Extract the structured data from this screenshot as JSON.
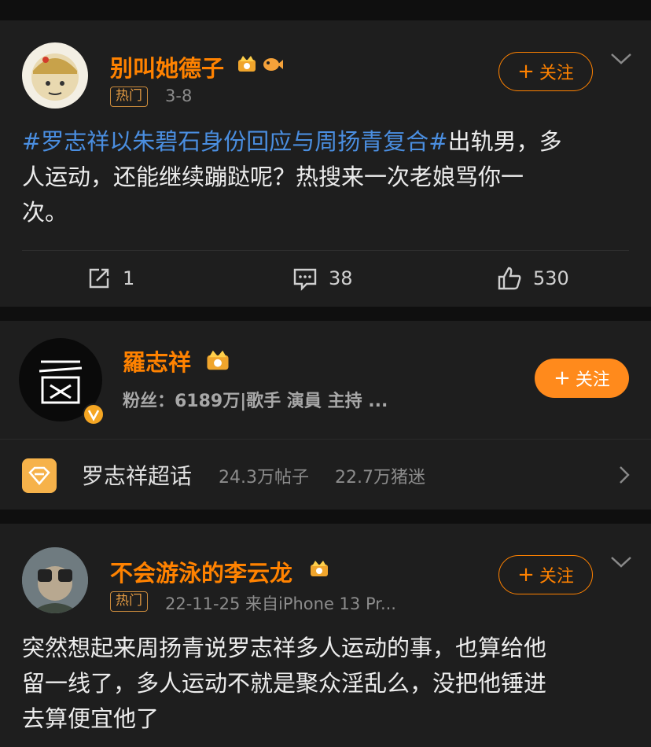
{
  "post1": {
    "username": "别叫她德子",
    "hot_tag": "热门",
    "date": "3-8",
    "follow_label": "关注",
    "topic": "#罗志祥以朱碧石身份回应与周扬青复合#",
    "text_line1_rest": "出轨男，多",
    "text_line2": "人运动，还能继续蹦跶呢？热搜来一次老娘骂你一",
    "text_line3": "次。",
    "actions": {
      "repost": "1",
      "comment": "38",
      "like": "530"
    }
  },
  "profile": {
    "name": "羅志祥",
    "fans_line": "粉丝：6189万|歌手 演員 主持 ...",
    "follow_label": "关注",
    "super_topic": "罗志祥超话",
    "posts_stat": "24.3万帖子",
    "fans_stat": "22.7万猪迷"
  },
  "post2": {
    "username": "不会游泳的李云龙",
    "hot_tag": "热门",
    "meta": "22-11-25  来自iPhone 13 Pr...",
    "follow_label": "关注",
    "text_line1": "突然想起来周扬青说罗志祥多人运动的事，也算给他",
    "text_line2": "留一线了，多人运动不就是聚众淫乱么，没把他锤进",
    "text_line3": "去算便宜他了"
  },
  "icons": [
    "crown-badge-icon",
    "fish-badge-icon",
    "repost-icon",
    "comment-icon",
    "like-icon",
    "chevron-down-icon",
    "chevron-right-icon",
    "verified-icon",
    "diamond-icon"
  ],
  "colors": {
    "accent": "#ff8200",
    "topic": "#4a8ee0",
    "background": "#1e1e1e"
  }
}
